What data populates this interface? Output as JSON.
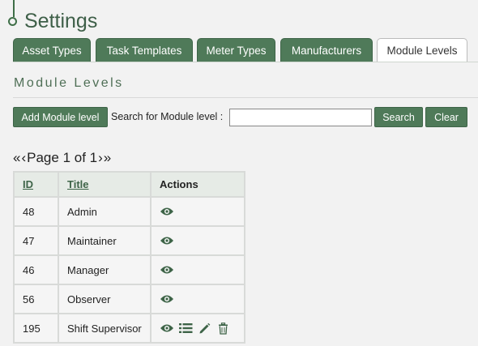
{
  "header": {
    "title": "Settings"
  },
  "tabs": [
    {
      "label": "Asset Types",
      "active": false
    },
    {
      "label": "Task Templates",
      "active": false
    },
    {
      "label": "Meter Types",
      "active": false
    },
    {
      "label": "Manufacturers",
      "active": false
    },
    {
      "label": "Module Levels",
      "active": true
    }
  ],
  "section": {
    "title": "Module Levels"
  },
  "toolbar": {
    "add_label": "Add Module level",
    "search_label": "Search for Module level :",
    "search_value": "",
    "search_button": "Search",
    "clear_button": "Clear"
  },
  "pager": {
    "first": "«",
    "prev": "‹",
    "text": "Page 1 of 1",
    "next": "›",
    "last": "»"
  },
  "table": {
    "headers": [
      "ID",
      "Title",
      "Actions"
    ],
    "rows": [
      {
        "id": "48",
        "title": "Admin",
        "actions": [
          "view-icon"
        ]
      },
      {
        "id": "47",
        "title": "Maintainer",
        "actions": [
          "view-icon"
        ]
      },
      {
        "id": "46",
        "title": "Manager",
        "actions": [
          "view-icon"
        ]
      },
      {
        "id": "56",
        "title": "Observer",
        "actions": [
          "view-icon"
        ]
      },
      {
        "id": "195",
        "title": "Shift Supervisor",
        "actions": [
          "view-icon",
          "list-icon",
          "edit-icon",
          "delete-icon"
        ]
      }
    ]
  },
  "colors": {
    "accent": "#4f7a59",
    "title": "#3e5f48"
  }
}
